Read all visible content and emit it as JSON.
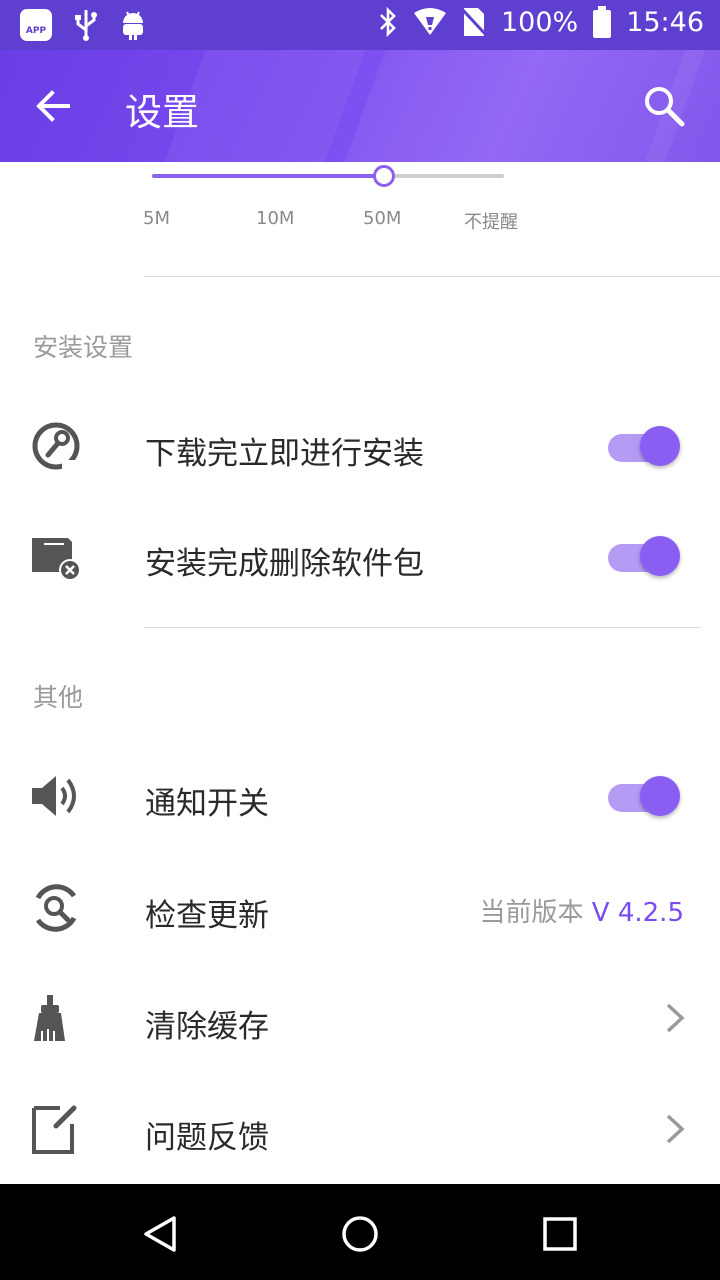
{
  "status_bar": {
    "app_badge": "APP",
    "battery": "100%",
    "time": "15:46"
  },
  "toolbar": {
    "title": "设置"
  },
  "download_size_slider": {
    "ticks": [
      "5M",
      "10M",
      "50M",
      "不提醒"
    ],
    "selected": "50M",
    "level_fraction": 0.66
  },
  "install_section": {
    "header": "安装设置",
    "items": [
      {
        "label": "下载完立即进行安装",
        "toggle_on": true,
        "icon": "install-wrench-icon"
      },
      {
        "label": "安装完成删除软件包",
        "toggle_on": true,
        "icon": "delete-package-icon"
      }
    ]
  },
  "other_section": {
    "header": "其他",
    "items": [
      {
        "label": "通知开关",
        "toggle_on": true,
        "icon": "speaker-icon"
      },
      {
        "label": "检查更新",
        "icon": "update-search-icon",
        "version_prefix": "当前版本",
        "version_value": "V 4.2.5"
      },
      {
        "label": "清除缓存",
        "icon": "broom-icon"
      },
      {
        "label": "问题反馈",
        "icon": "feedback-edit-icon"
      }
    ]
  },
  "colors": {
    "accent": "#8a5ef2",
    "toolbar": "#7b4cf0",
    "status_bar": "#5f3fd0"
  }
}
